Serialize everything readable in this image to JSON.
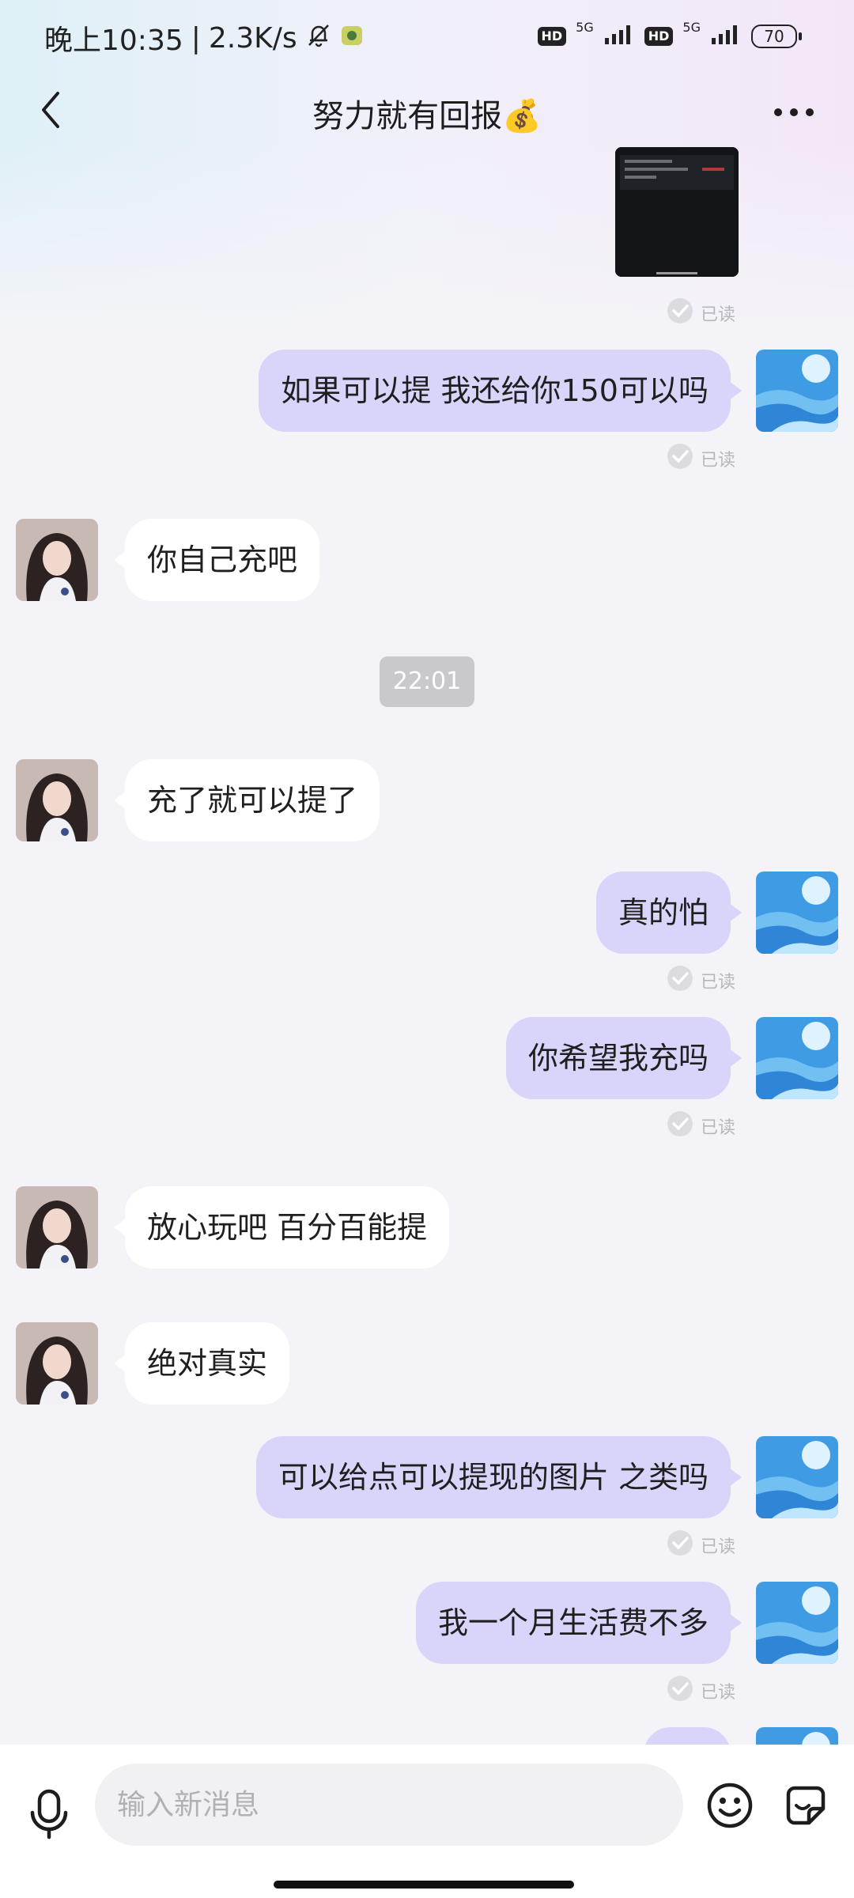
{
  "status_bar": {
    "time": "晚上10:35",
    "separator": "|",
    "speed": "2.3K/s",
    "hd1": "HD",
    "net1": "5G",
    "hd2": "HD",
    "net2": "5G",
    "battery": "70"
  },
  "header": {
    "title": "努力就有回报💰",
    "back_icon": "chevron-left-icon",
    "more_icon": "more-horizontal-icon"
  },
  "messages": {
    "read_label": "已读",
    "time_divider": "22:01",
    "texts": [
      "如果可以提 我还给你150可以吗",
      "你自己充吧",
      "充了就可以提了",
      "真的怕",
      "你希望我充吗",
      "放心玩吧 百分百能提",
      "绝对真实",
      "可以给点可以提现的图片 之类吗",
      "我一个月生活费不多"
    ]
  },
  "composer": {
    "placeholder": "输入新消息",
    "mic_icon": "microphone-icon",
    "emoji_icon": "emoji-icon",
    "sticker_icon": "sticker-icon"
  },
  "colors": {
    "outgoing_bubble": "#d8d4fa",
    "incoming_bubble": "#ffffff",
    "background": "#f4f4f8",
    "timestamp_bg": "#c9c9cd"
  }
}
